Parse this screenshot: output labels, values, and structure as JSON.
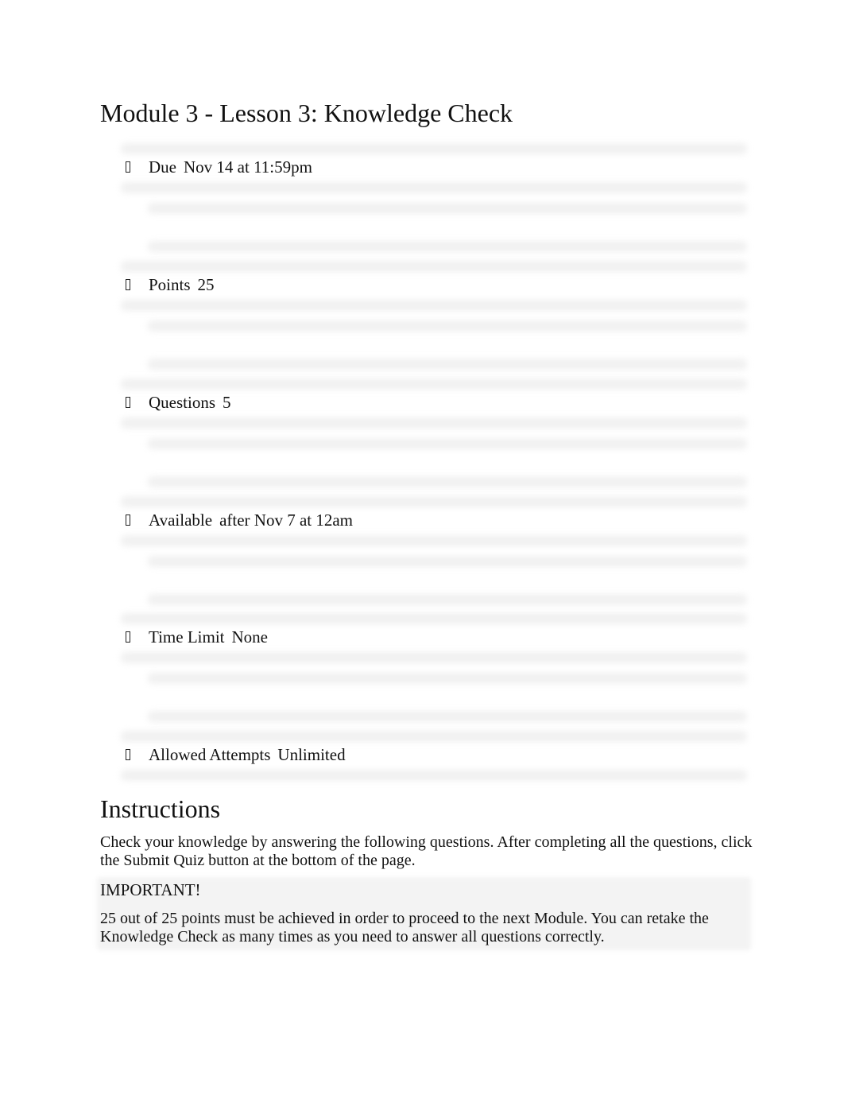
{
  "page": {
    "title": "Module 3 - Lesson 3: Knowledge Check"
  },
  "details": [
    {
      "icon": "missing-glyph-icon",
      "label": "Due",
      "value": "Nov 14 at 11:59pm"
    },
    {
      "icon": "missing-glyph-icon",
      "label": "Points",
      "value": "25"
    },
    {
      "icon": "missing-glyph-icon",
      "label": "Questions",
      "value": "5"
    },
    {
      "icon": "missing-glyph-icon",
      "label": "Available",
      "value": "after Nov 7 at 12am"
    },
    {
      "icon": "missing-glyph-icon",
      "label": "Time Limit",
      "value": "None"
    },
    {
      "icon": "missing-glyph-icon",
      "label": "Allowed Attempts",
      "value": "Unlimited"
    }
  ],
  "instructions": {
    "heading": "Instructions",
    "text": "Check your knowledge by answering the following questions. After completing all the questions, click the Submit Quiz button at the bottom of the page.",
    "important": {
      "title": "IMPORTANT!",
      "text": "25 out of 25 points must be achieved in order to proceed to the next Module. You can retake the Knowledge Check as many times as you need to answer all questions correctly."
    }
  }
}
